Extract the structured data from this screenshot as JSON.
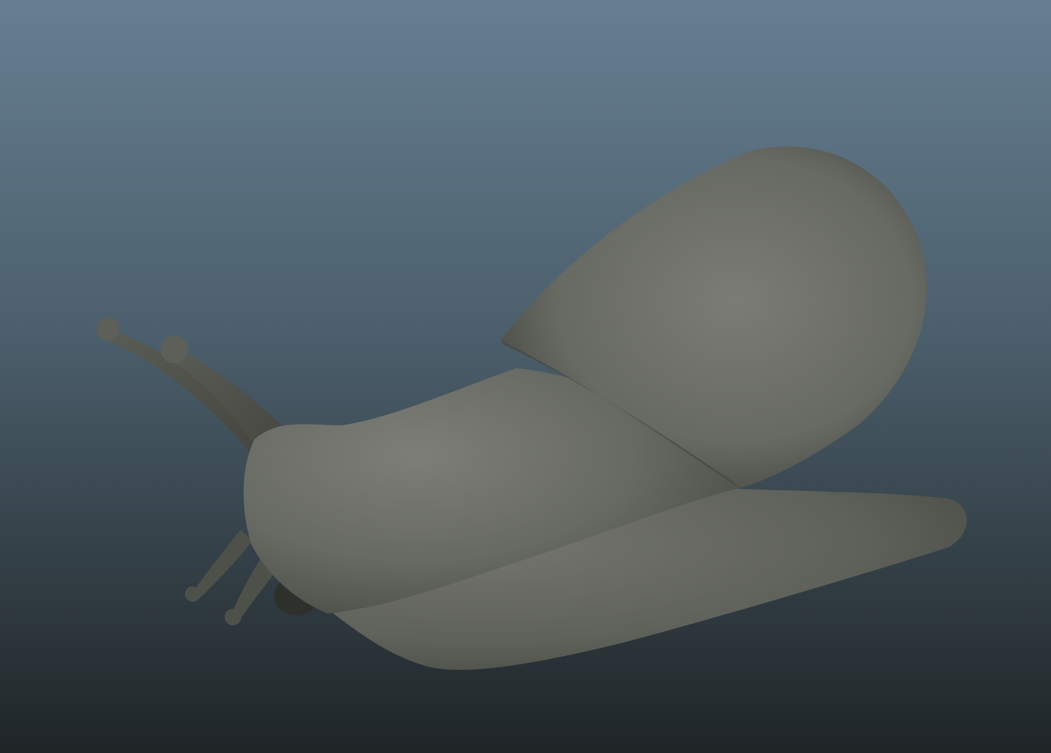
{
  "viewport": {
    "background_top": "#667f91",
    "background_bottom": "#1f2527",
    "model": "snail",
    "shading": "smooth gray",
    "model_color": "#6c6e68"
  }
}
